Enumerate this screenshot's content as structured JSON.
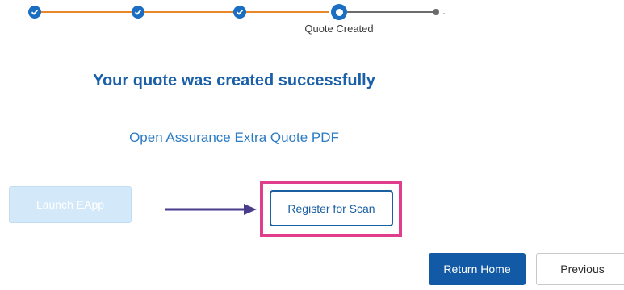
{
  "progress": {
    "current_step_label": "Quote Created",
    "completed_color": "#e8872a",
    "pending_color": "#6b6b6b",
    "accent_color": "#1b6ec2"
  },
  "main": {
    "headline": "Your quote was created successfully",
    "pdf_link": "Open Assurance Extra Quote PDF"
  },
  "actions": {
    "launch_eapp_label": "Launch EApp",
    "register_scan_label": "Register for Scan",
    "return_home_label": "Return Home",
    "previous_label": "Previous"
  },
  "annotation": {
    "highlight_color": "#e03e8c",
    "arrow_color": "#4a3c8c"
  }
}
